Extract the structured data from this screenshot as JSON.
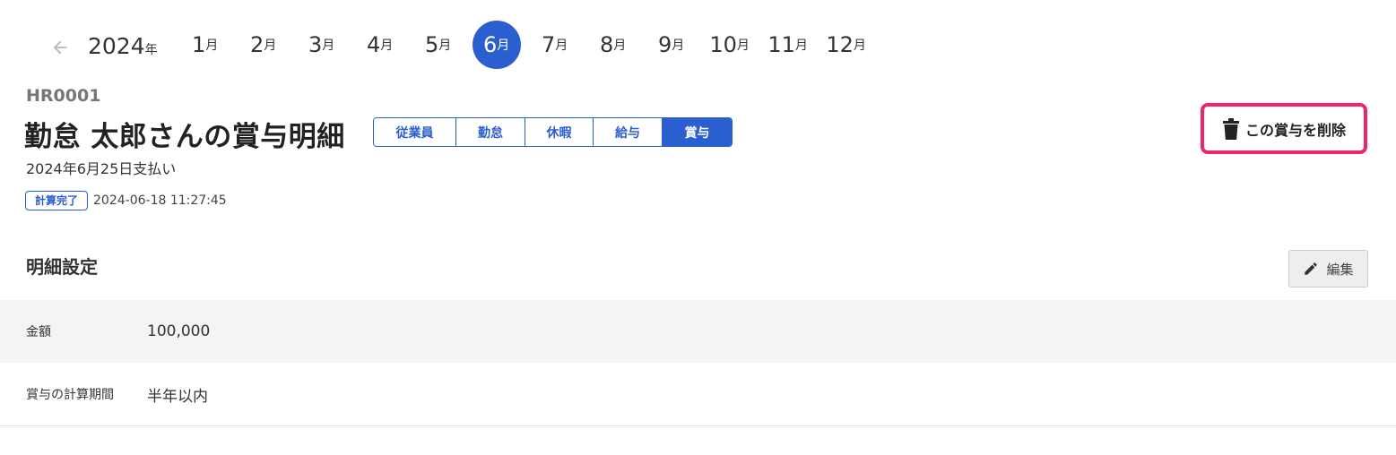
{
  "month_nav": {
    "back_icon": "arrow-left-icon",
    "year": "2024",
    "year_suffix": "年",
    "month_suffix": "月",
    "months": [
      "1",
      "2",
      "3",
      "4",
      "5",
      "6",
      "7",
      "8",
      "9",
      "10",
      "11",
      "12"
    ],
    "active_month": "6"
  },
  "employee": {
    "code": "HR0001",
    "title": "勤怠 太郎さんの賞与明細",
    "pay_date": "2024年6月25日支払い"
  },
  "tabs": [
    {
      "label": "従業員",
      "active": false
    },
    {
      "label": "勤怠",
      "active": false
    },
    {
      "label": "休暇",
      "active": false
    },
    {
      "label": "給与",
      "active": false
    },
    {
      "label": "賞与",
      "active": true
    }
  ],
  "status": {
    "badge": "計算完了",
    "timestamp": "2024-06-18 11:27:45"
  },
  "delete_button": {
    "label": "この賞与を削除",
    "icon": "trash-icon",
    "highlight_color": "#f0266d"
  },
  "section": {
    "title": "明細設定",
    "edit_label": "編集",
    "edit_icon": "pencil-icon"
  },
  "details": [
    {
      "label": "金額",
      "value": "100,000"
    },
    {
      "label": "賞与の計算期間",
      "value": "半年以内"
    }
  ],
  "colors": {
    "accent": "#2b5fcf",
    "row_shade": "#f5f3f3"
  }
}
